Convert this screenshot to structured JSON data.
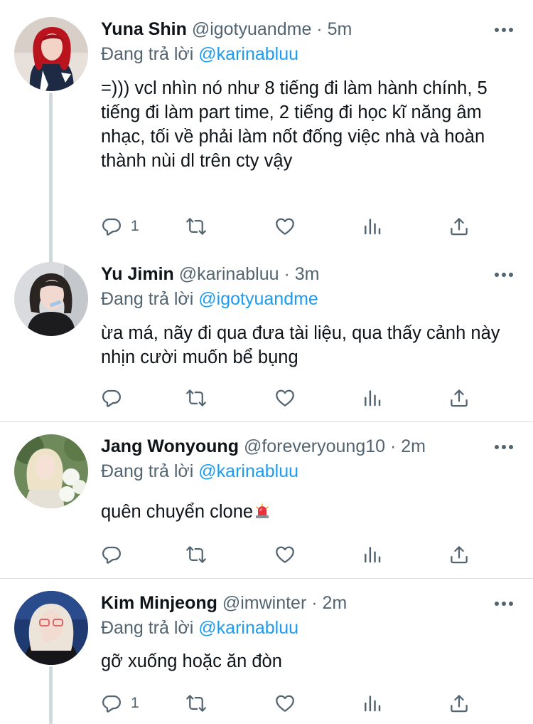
{
  "colors": {
    "accent": "#1d9bf0",
    "secondary_text": "#536471",
    "primary_text": "#0f1419",
    "thread_line": "#cfd9de",
    "divider": "#d9dde0"
  },
  "icons": [
    "more-icon",
    "reply-icon",
    "retweet-icon",
    "like-icon",
    "stats-icon",
    "share-icon",
    "police-light-emoji"
  ],
  "tweets": [
    {
      "name": "Yuna Shin",
      "handle": "@igotyuandme",
      "separator": "·",
      "time": "5m",
      "reply_prefix": "Đang trả lời",
      "reply_to": "@karinabluu",
      "text": "=))) vcl nhìn nó như 8 tiếng đi làm hành chính, 5 tiếng đi làm part time, 2 tiếng đi học kĩ năng âm nhạc, tối về phải làm nốt đống việc nhà và hoàn thành nùi dl trên cty vậy",
      "reply_count": "1"
    },
    {
      "name": "Yu Jimin",
      "handle": "@karinabluu",
      "separator": "·",
      "time": "3m",
      "reply_prefix": "Đang trả lời",
      "reply_to": "@igotyuandme",
      "text": "ừa má, nãy đi qua đưa tài liệu, qua thấy cảnh này nhịn cười muốn bể bụng",
      "reply_count": ""
    },
    {
      "name": "Jang Wonyoung",
      "handle": "@foreveryoung10",
      "separator": "·",
      "time": "2m",
      "reply_prefix": "Đang trả lời",
      "reply_to": "@karinabluu",
      "text": "quên chuyển clone",
      "reply_count": ""
    },
    {
      "name": "Kim Minjeong",
      "handle": "@imwinter",
      "separator": "·",
      "time": "2m",
      "reply_prefix": "Đang trả lời",
      "reply_to": "@karinabluu",
      "text": "gỡ xuống hoặc ăn đòn",
      "reply_count": "1"
    }
  ]
}
